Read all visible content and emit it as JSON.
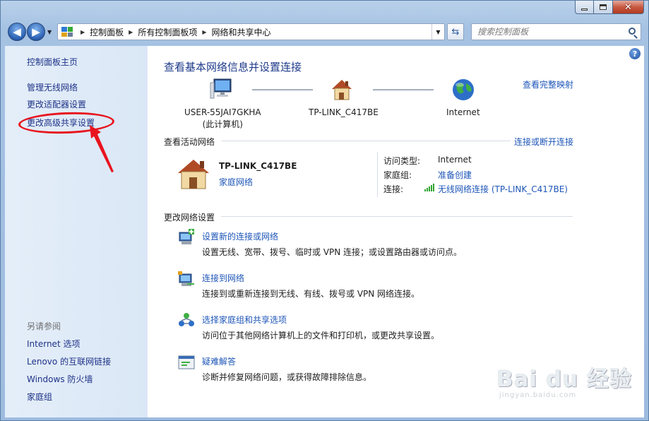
{
  "window": {
    "controls": {
      "minimize_icon": "minimize-icon",
      "maximize_icon": "maximize-icon",
      "close_icon": "close-icon"
    }
  },
  "navbar": {
    "breadcrumb": [
      "控制面板",
      "所有控制面板项",
      "网络和共享中心"
    ],
    "search_placeholder": "搜索控制面板"
  },
  "sidebar": {
    "links": [
      "控制面板主页",
      "管理无线网络",
      "更改适配器设置",
      "更改高级共享设置"
    ],
    "see_also_title": "另请参阅",
    "see_also_links": [
      "Internet 选项",
      "Lenovo 的互联网链接",
      "Windows 防火墙",
      "家庭组"
    ],
    "highlight_color": "#e8141e"
  },
  "main": {
    "title": "查看基本网络信息并设置连接",
    "view_full_map": "查看完整映射",
    "nodes": [
      {
        "line1": "USER-55JAI7GKHA",
        "line2": "(此计算机)"
      },
      {
        "line1": "TP-LINK_C417BE",
        "line2": ""
      },
      {
        "line1": "Internet",
        "line2": ""
      }
    ],
    "active_networks_title": "查看活动网络",
    "connect_disconnect": "连接或断开连接",
    "network": {
      "name": "TP-LINK_C417BE",
      "type": "家庭网络",
      "props": [
        {
          "label": "访问类型:",
          "value": "Internet",
          "link": false
        },
        {
          "label": "家庭组:",
          "value": "准备创建",
          "link": true
        },
        {
          "label": "连接:",
          "value": "无线网络连接 (TP-LINK_C417BE)",
          "link": true
        }
      ]
    },
    "change_settings_title": "更改网络设置",
    "tasks": [
      {
        "title": "设置新的连接或网络",
        "desc": "设置无线、宽带、拨号、临时或 VPN 连接；或设置路由器或访问点。"
      },
      {
        "title": "连接到网络",
        "desc": "连接到或重新连接到无线、有线、拨号或 VPN 网络连接。"
      },
      {
        "title": "选择家庭组和共享选项",
        "desc": "访问位于其他网络计算机上的文件和打印机，或更改共享设置。"
      },
      {
        "title": "疑难解答",
        "desc": "诊断并修复网络问题，或获得故障排除信息。"
      }
    ]
  },
  "watermark": {
    "main": "Bai du 经验",
    "sub": "jingyan.baidu.com"
  }
}
